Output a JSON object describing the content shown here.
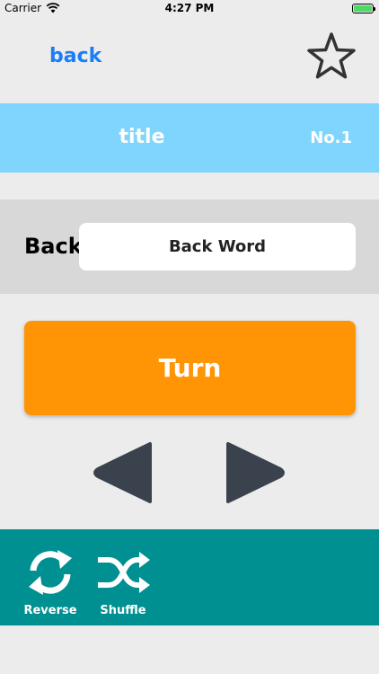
{
  "status_bar": {
    "carrier": "Carrier",
    "time": "4:27 PM",
    "icons": [
      "wifi-icon",
      "battery-icon"
    ]
  },
  "nav": {
    "back_label": "back",
    "favorite_icon": "star-outline-icon"
  },
  "title_bar": {
    "title": "title",
    "number": "No.1",
    "color": "#7fd5fd"
  },
  "card": {
    "side_label": "Back",
    "word": "Back Word"
  },
  "turn_button": {
    "label": "Turn",
    "color": "#ff9504"
  },
  "navigation": {
    "prev_icon": "triangle-left-icon",
    "next_icon": "triangle-right-icon"
  },
  "toolbar": {
    "color": "#009091",
    "items": [
      {
        "label": "Reverse",
        "icon": "reverse-icon"
      },
      {
        "label": "Shuffle",
        "icon": "shuffle-icon"
      }
    ]
  }
}
